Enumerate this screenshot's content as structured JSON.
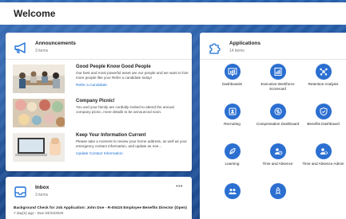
{
  "page": {
    "title": "Welcome"
  },
  "announcements": {
    "title": "Announcements",
    "count": "3 items",
    "items": [
      {
        "title": "Good People Know Good People",
        "body": "Our best and most powerful asset are our people and we want to hire more people like you! Refer a candidate today!",
        "link": "Refer a Candidate"
      },
      {
        "title": "Company Picnic!",
        "body": "You and your family are cordially invited to attend the annual company picnic, more details to be announced soon.",
        "link": ""
      },
      {
        "title": "Keep Your Information Current",
        "body": "Please take a moment to review your home address, as well as your emergency contact information, and update as nee...",
        "link": "Update Contact Information"
      }
    ]
  },
  "inbox": {
    "title": "Inbox",
    "count": "3 items",
    "more": "•••",
    "items": [
      {
        "title": "Background Check for Job Application: John Doe - R-00415 Employee Benefits Director (Open)",
        "meta": "7 day(s) ago - Due 04/24/2020"
      }
    ]
  },
  "applications": {
    "title": "Applications",
    "count": "14 items",
    "accent": "#2b6fd1",
    "apps": [
      {
        "label": "Dashboards",
        "icon": "dashboard-icon"
      },
      {
        "label": "Executive Workforce Scorecard",
        "icon": "scorecard-icon"
      },
      {
        "label": "Retention Analysis",
        "icon": "network-icon"
      },
      {
        "label": "Recruiting",
        "icon": "id-card-icon"
      },
      {
        "label": "Compensation Dashboard",
        "icon": "compensation-icon"
      },
      {
        "label": "Benefits Dashboard",
        "icon": "shield-icon"
      },
      {
        "label": "Learning",
        "icon": "learning-icon"
      },
      {
        "label": "Time and Absence",
        "icon": "person-clock-icon"
      },
      {
        "label": "Time and Absence Admin",
        "icon": "person-gear-icon"
      },
      {
        "label": "",
        "icon": "people-icon"
      },
      {
        "label": "",
        "icon": "rocket-icon"
      }
    ]
  }
}
